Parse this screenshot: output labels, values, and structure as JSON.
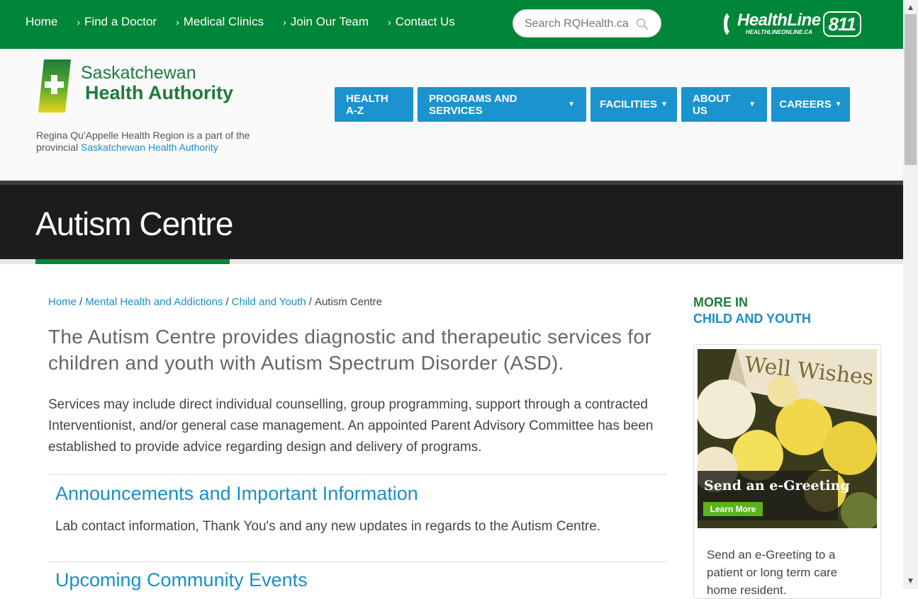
{
  "top_nav": {
    "items": [
      {
        "label": "Home",
        "has_chevron": false
      },
      {
        "label": "Find a Doctor",
        "has_chevron": true
      },
      {
        "label": "Medical Clinics",
        "has_chevron": true
      },
      {
        "label": "Join Our Team",
        "has_chevron": true
      },
      {
        "label": "Contact Us",
        "has_chevron": true
      }
    ],
    "search_placeholder": "Search RQHealth.ca",
    "search_icon": "search-icon"
  },
  "healthline": {
    "name": "HealthLine",
    "url": "HEALTHLINEONLINE.CA",
    "number": "811"
  },
  "logo": {
    "line1": "Saskatchewan",
    "line2": "Health Authority"
  },
  "region_note": {
    "text": "Regina Qu'Appelle Health Region is a part of the provincial ",
    "link": "Saskatchewan Health Authority"
  },
  "main_nav": [
    {
      "label": "HEALTH A-Z",
      "dropdown": false
    },
    {
      "label": "PROGRAMS AND SERVICES",
      "dropdown": true
    },
    {
      "label": "FACILITIES",
      "dropdown": true
    },
    {
      "label": "ABOUT US",
      "dropdown": true
    },
    {
      "label": "CAREERS",
      "dropdown": true
    }
  ],
  "page": {
    "title": "Autism Centre",
    "breadcrumb": [
      "Home",
      "Mental Health and Addictions",
      "Child and Youth",
      "Autism Centre"
    ],
    "lead": "The Autism Centre provides diagnostic and therapeutic services for children and youth with Autism Spectrum Disorder (ASD).",
    "body": "Services may include direct individual counselling, group programming, support through a contracted Interventionist, and/or general case management. An appointed Parent Advisory Committee has been established to provide advice regarding design and delivery of programs.",
    "sections": [
      {
        "title": "Announcements and Important Information",
        "description": "Lab contact information, Thank You's and any new updates in regards to the Autism Centre."
      },
      {
        "title": "Upcoming Community Events",
        "description": ""
      }
    ]
  },
  "sidebar": {
    "heading_line1": "MORE IN",
    "heading_line2": "CHILD AND YOUTH",
    "card": {
      "image_heading": "Well Wishes",
      "image_title": "Send an e-Greeting",
      "image_button": "Learn More",
      "text": "Send an e-Greeting to a patient or long term care home resident."
    }
  },
  "colors": {
    "brand_green": "#008638",
    "link_blue": "#1a8fc6",
    "nav_blue": "#1a93cf",
    "banner_dark": "#1c1c1c"
  }
}
